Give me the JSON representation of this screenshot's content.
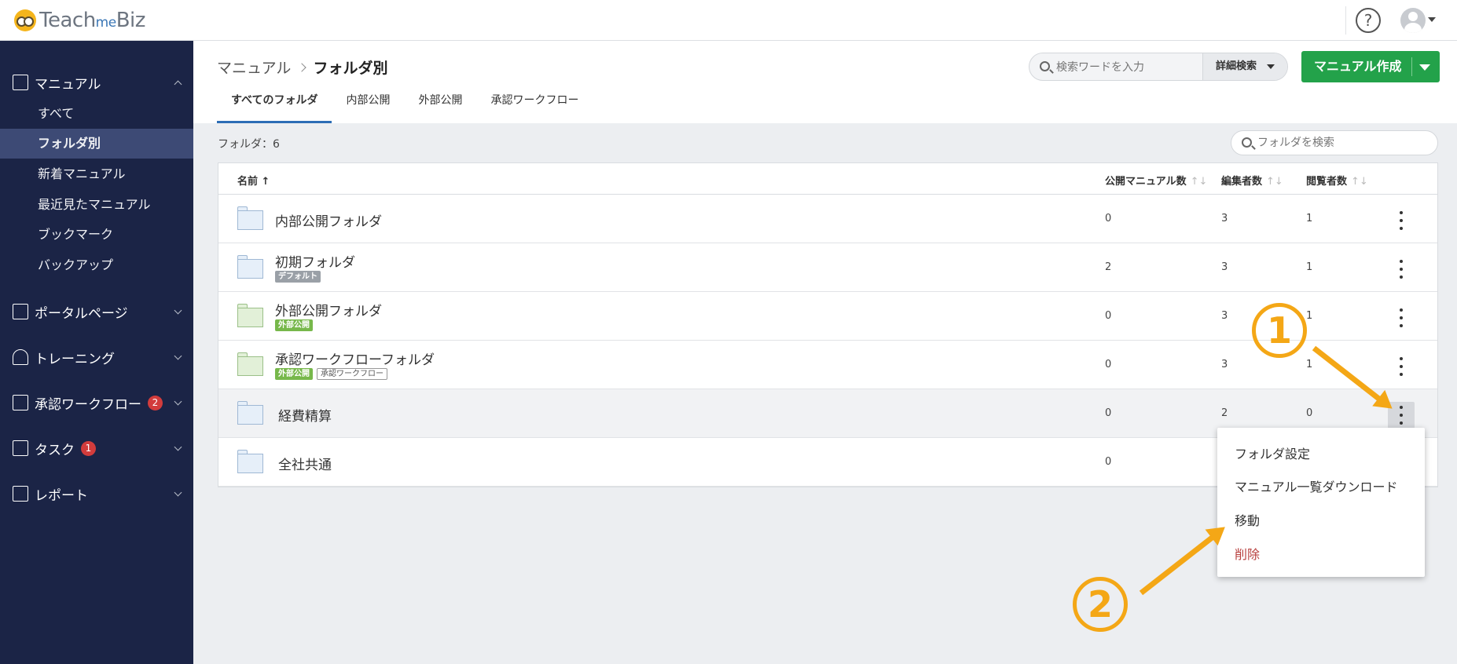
{
  "app": {
    "logo_teach": "Teach",
    "logo_me": "me",
    "logo_biz": "Biz",
    "help_icon": "?",
    "avatar_icon": "user-icon"
  },
  "sidebar": {
    "manual": "マニュアル",
    "manual_items": [
      "すべて",
      "フォルダ別",
      "新着マニュアル",
      "最近見たマニュアル",
      "ブックマーク",
      "バックアップ"
    ],
    "portal": "ポータルページ",
    "training": "トレーニング",
    "approval": "承認ワークフロー",
    "approval_badge": "2",
    "task": "タスク",
    "task_badge": "1",
    "report": "レポート"
  },
  "header": {
    "breadcrumb_root": "マニュアル",
    "breadcrumb_current": "フォルダ別",
    "search_placeholder": "検索ワードを入力",
    "advanced_search": "詳細検索",
    "create_button": "マニュアル作成"
  },
  "tabs": [
    "すべてのフォルダ",
    "内部公開",
    "外部公開",
    "承認ワークフロー"
  ],
  "list": {
    "count_label": "フォルダ：6",
    "folder_search_placeholder": "フォルダを検索",
    "columns": {
      "name": "名前",
      "name_sort": "↑",
      "published": "公開マニュアル数",
      "editors": "編集者数",
      "viewers": "閲覧者数",
      "sort_icon": "↑↓"
    },
    "rows": [
      {
        "name": "内部公開フォルダ",
        "published": "0",
        "editors": "3",
        "viewers": "1"
      },
      {
        "name": "初期フォルダ",
        "tag1": "デフォルト",
        "published": "2",
        "editors": "3",
        "viewers": "1"
      },
      {
        "name": "外部公開フォルダ",
        "tag1": "外部公開",
        "published": "0",
        "editors": "3",
        "viewers": "1"
      },
      {
        "name": "承認ワークフローフォルダ",
        "tag1": "外部公開",
        "tag2": "承認ワークフロー",
        "published": "0",
        "editors": "3",
        "viewers": "1"
      },
      {
        "name": "経費精算",
        "published": "0",
        "editors": "2",
        "viewers": "0"
      },
      {
        "name": "全社共通",
        "published": "0"
      }
    ]
  },
  "context_menu": [
    "フォルダ設定",
    "マニュアル一覧ダウンロード",
    "移動",
    "削除"
  ],
  "annotations": {
    "step1": "1",
    "step2": "2"
  }
}
